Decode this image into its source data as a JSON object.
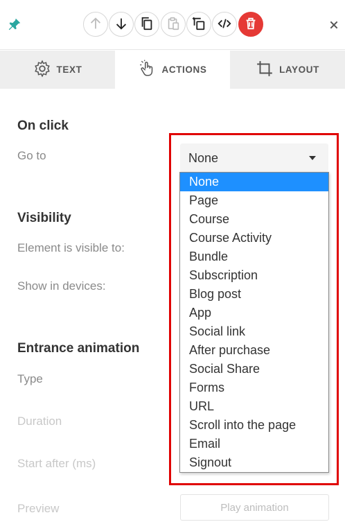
{
  "toolbar": {
    "icons": [
      "pin-icon",
      "arrow-up-icon",
      "arrow-down-icon",
      "copy-icon",
      "paste-icon",
      "duplicate-icon",
      "code-icon",
      "trash-icon",
      "close-icon"
    ],
    "delete_color": "#e53935"
  },
  "tabs": [
    {
      "label": "TEXT",
      "icon": "gear-icon",
      "active": false
    },
    {
      "label": "ACTIONS",
      "icon": "pointer-hand-icon",
      "active": true
    },
    {
      "label": "LAYOUT",
      "icon": "crop-icon",
      "active": false
    }
  ],
  "on_click": {
    "title": "On click",
    "goto_label": "Go to",
    "selected_value": "None",
    "options": [
      "None",
      "Page",
      "Course",
      "Course Activity",
      "Bundle",
      "Subscription",
      "Blog post",
      "App",
      "Social link",
      "After purchase",
      "Social Share",
      "Forms",
      "URL",
      "Scroll into the page",
      "Email",
      "Signout"
    ]
  },
  "visibility": {
    "title": "Visibility",
    "visible_to_label": "Element is visible to:",
    "devices_label": "Show in devices:"
  },
  "animation": {
    "title": "Entrance animation",
    "type_label": "Type",
    "duration_label": "Duration",
    "start_after_label": "Start after (ms)",
    "preview_label": "Preview",
    "play_button": "Play animation"
  },
  "colors": {
    "highlight": "#e00000",
    "selected_option": "#1e90ff"
  }
}
